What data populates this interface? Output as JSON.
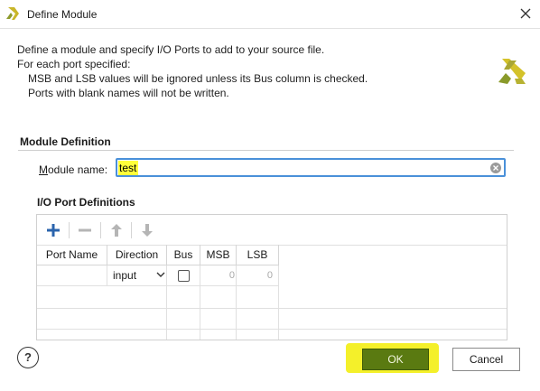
{
  "window": {
    "title": "Define Module"
  },
  "intro": {
    "line1": "Define a module and specify I/O Ports to add to your source file.",
    "line2": "For each port specified:",
    "line3": "MSB and LSB values will be ignored unless its Bus column is checked.",
    "line4": "Ports with blank names will not be written."
  },
  "module_definition": {
    "section_title": "Module Definition",
    "name_label_mnemonic": "M",
    "name_label_rest": "odule name:",
    "name_value": "test"
  },
  "io_ports": {
    "section_title": "I/O Port Definitions",
    "toolbar": {
      "add_icon": "plus-icon",
      "remove_icon": "minus-icon",
      "move_up_icon": "arrow-up-icon",
      "move_down_icon": "arrow-down-icon"
    },
    "columns": [
      "Port Name",
      "Direction",
      "Bus",
      "MSB",
      "LSB"
    ],
    "rows": [
      {
        "port_name": "",
        "direction": "input",
        "bus": false,
        "msb": "0",
        "lsb": "0"
      }
    ]
  },
  "buttons": {
    "help": "?",
    "ok": "OK",
    "cancel": "Cancel"
  },
  "colors": {
    "focus_border": "#4a90d9",
    "highlight": "#ffff3a",
    "ok_fill": "#5a7a11",
    "brand_yellow": "#d4c22a",
    "brand_green": "#8a9a2a"
  }
}
